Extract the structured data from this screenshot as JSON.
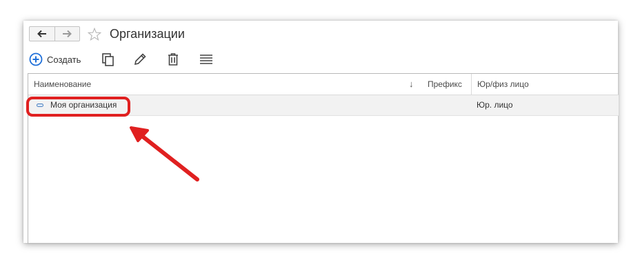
{
  "window": {
    "title": "Организации"
  },
  "nav": {
    "back_icon": "arrow-left-icon",
    "forward_icon": "arrow-right-icon",
    "favorite_icon": "star-outline-icon"
  },
  "toolbar": {
    "create_label": "Создать",
    "create_icon": "plus-circle-icon",
    "copy_icon": "copy-icon",
    "edit_icon": "pencil-icon",
    "delete_icon": "trash-icon",
    "more_icon": "menu-lines-icon"
  },
  "table": {
    "columns": [
      {
        "label": "Наименование",
        "sort": "↓"
      },
      {
        "label": "Префикс"
      },
      {
        "label": "Юр/физ лицо"
      }
    ],
    "rows": [
      {
        "name": "Моя организация",
        "prefix": "",
        "type": "Юр. лицо"
      }
    ]
  },
  "colors": {
    "accent": "#1e6fd9",
    "annotation": "#e02020",
    "row_selected": "#f2f2f2"
  }
}
